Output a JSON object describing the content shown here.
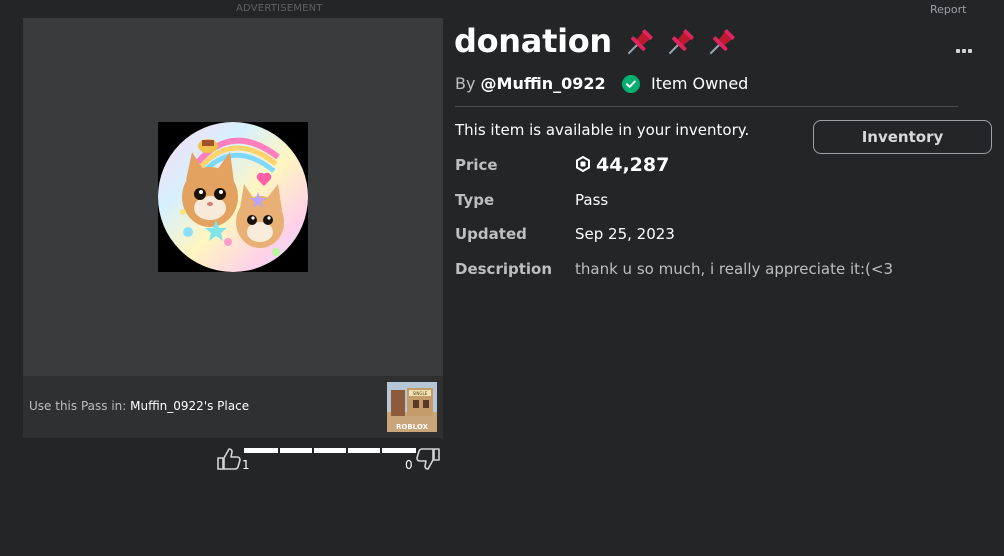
{
  "ad": {
    "label": "ADVERTISEMENT"
  },
  "report": {
    "label": "Report"
  },
  "item": {
    "title": "donation",
    "title_emoji": "pushpin",
    "title_emoji_count": 3,
    "creator_prefix": "By ",
    "creator": "@Muffin_0922",
    "owned_label": "Item Owned",
    "availability_text": "This item is available in your inventory.",
    "inventory_button": "Inventory"
  },
  "details": {
    "price_label": "Price",
    "price_value": "44,287",
    "type_label": "Type",
    "type_value": "Pass",
    "updated_label": "Updated",
    "updated_value": "Sep 25, 2023",
    "description_label": "Description",
    "description_value": "thank u so much, i really appreciate it:(<3"
  },
  "pass": {
    "prefix": "Use this Pass in: ",
    "place_name": "Muffin_0922's Place",
    "place_thumb_text": "ROBLOX",
    "place_sign_text": "SINGLE"
  },
  "votes": {
    "up_count": "1",
    "down_count": "0",
    "up_ratio": 1.0
  },
  "colors": {
    "background": "#232527",
    "panel": "#393b3d",
    "owned_check": "#00b06f",
    "pin": "#e0245e"
  },
  "icons": {
    "currency": "robux-icon",
    "owned": "check-circle-icon",
    "more": "more-options-icon",
    "vote_up": "thumbs-up-icon",
    "vote_down": "thumbs-down-icon"
  }
}
